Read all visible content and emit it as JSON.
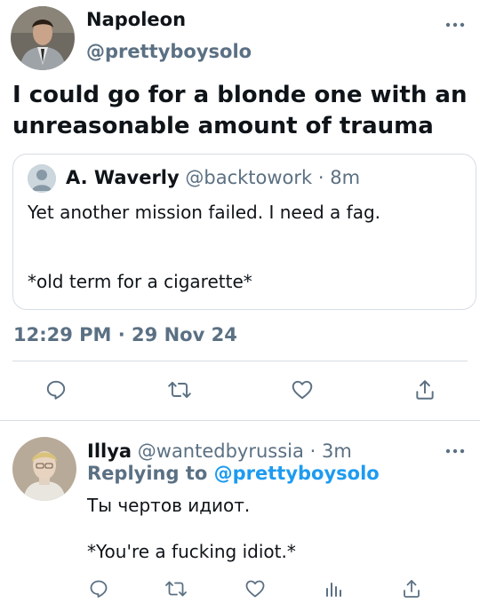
{
  "colors": {
    "text": "#0f1419",
    "secondary": "#5b7083",
    "link": "#1d9bf0",
    "border": "#d6dde3"
  },
  "main_tweet": {
    "name": "Napoleon",
    "handle": "@prettyboysolo",
    "text": "I could go for a blonde one with an unreasonable amount of trauma",
    "more_icon": "more-dots-icon"
  },
  "quoted_tweet": {
    "name": "A. Waverly",
    "handle": "@backtowork",
    "separator": "·",
    "time": "8m",
    "line1": "Yet another mission failed. I need a fag.",
    "line2": "*old term for a cigarette*"
  },
  "timestamp": "12:29 PM · 29 Nov 24",
  "main_actions": [
    "reply-icon",
    "retweet-icon",
    "like-icon",
    "share-icon"
  ],
  "reply_tweet": {
    "name": "Illya",
    "handle": "@wantedbyrussia",
    "separator": "·",
    "time": "3m",
    "replying_label": "Replying to",
    "replying_to": "@prettyboysolo",
    "line1": "Ты чертов идиот.",
    "line2": "*You're a fucking idiot.*"
  },
  "reply_actions": [
    "reply-icon",
    "retweet-icon",
    "like-icon",
    "analytics-icon",
    "share-icon"
  ]
}
